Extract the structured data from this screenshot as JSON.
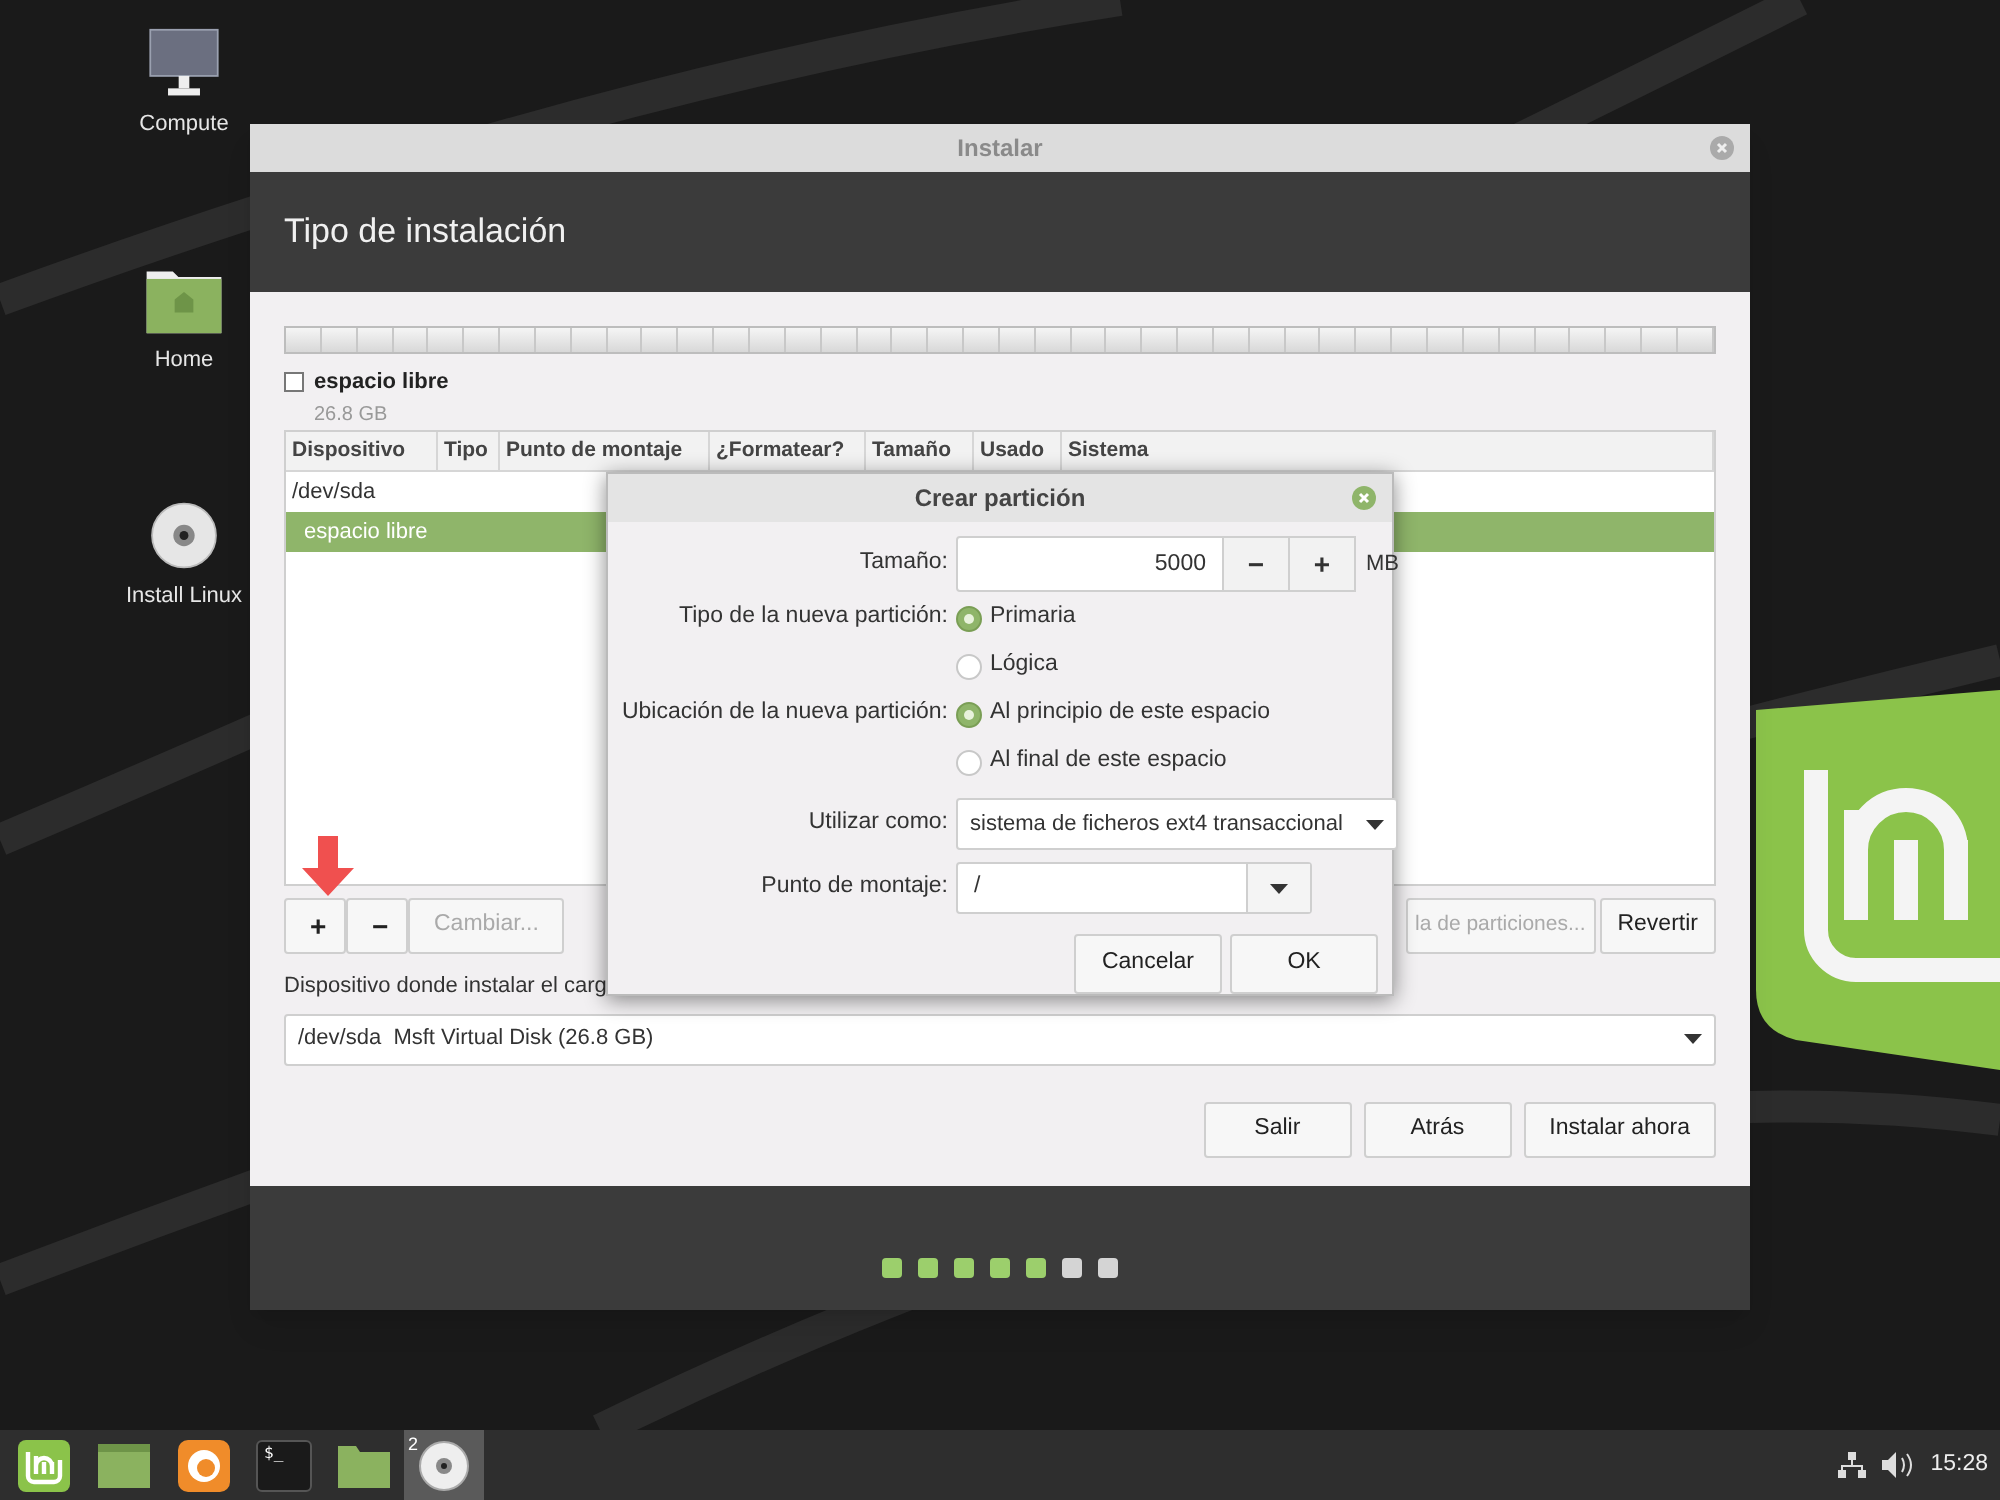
{
  "desktop_icons": [
    {
      "kind": "computer",
      "label": "Compute"
    },
    {
      "kind": "home",
      "label": "Home"
    },
    {
      "kind": "disc",
      "label": "Install Linux"
    }
  ],
  "window": {
    "title": "Instalar",
    "heading": "Tipo de instalación",
    "partition_legend": {
      "name": "espacio libre",
      "size": "26.8 GB"
    },
    "table": {
      "columns": [
        "Dispositivo",
        "Tipo",
        "Punto de montaje",
        "¿Formatear?",
        "Tamaño",
        "Usado",
        "Sistema"
      ],
      "rows": [
        {
          "device": "/dev/sda",
          "selected": false,
          "children": [
            {
              "device": "espacio libre",
              "selected": true
            }
          ]
        }
      ]
    },
    "partition_buttons": [
      {
        "label": "+",
        "disabled": false
      },
      {
        "label": "−",
        "disabled": false
      },
      {
        "label": "Cambiar...",
        "disabled": true
      }
    ],
    "table_buttons": [
      {
        "label": "la de particiones...",
        "disabled": true
      },
      {
        "label": "Revertir",
        "disabled": false
      }
    ],
    "bootloader_label": "Dispositivo donde instalar el carg",
    "bootloader_device": "/dev/sda  Msft Virtual Disk (26.8 GB)",
    "nav_buttons": [
      "Salir",
      "Atrás",
      "Instalar ahora"
    ],
    "steps": [
      {
        "done": true
      },
      {
        "done": true
      },
      {
        "done": true
      },
      {
        "done": true
      },
      {
        "done": true
      },
      {
        "done": false
      },
      {
        "done": false
      }
    ]
  },
  "dialog": {
    "title": "Crear partición",
    "size": {
      "label": "Tamaño:",
      "value": "5000",
      "minus": "−",
      "plus": "+",
      "unit": "MB"
    },
    "type": {
      "label": "Tipo de la nueva partición:",
      "options": [
        {
          "label": "Primaria",
          "selected": true
        },
        {
          "label": "Lógica",
          "selected": false
        }
      ]
    },
    "location": {
      "label": "Ubicación de la nueva partición:",
      "options": [
        {
          "label": "Al principio de este espacio",
          "selected": true
        },
        {
          "label": "Al final de este espacio",
          "selected": false
        }
      ]
    },
    "use_as": {
      "label": "Utilizar como:",
      "value": "sistema de ficheros ext4 transaccional"
    },
    "mount_point": {
      "label": "Punto de montaje:",
      "value": "/"
    },
    "buttons": [
      "Cancelar",
      "OK"
    ]
  },
  "taskbar": {
    "apps": [
      {
        "kind": "menu",
        "selected": false
      },
      {
        "kind": "desktop",
        "selected": false
      },
      {
        "kind": "firefox",
        "selected": false
      },
      {
        "kind": "terminal",
        "glyph": "$_",
        "selected": false
      },
      {
        "kind": "files",
        "selected": false
      },
      {
        "kind": "disc",
        "badge": "2",
        "selected": true
      }
    ],
    "clock": "15:28"
  }
}
